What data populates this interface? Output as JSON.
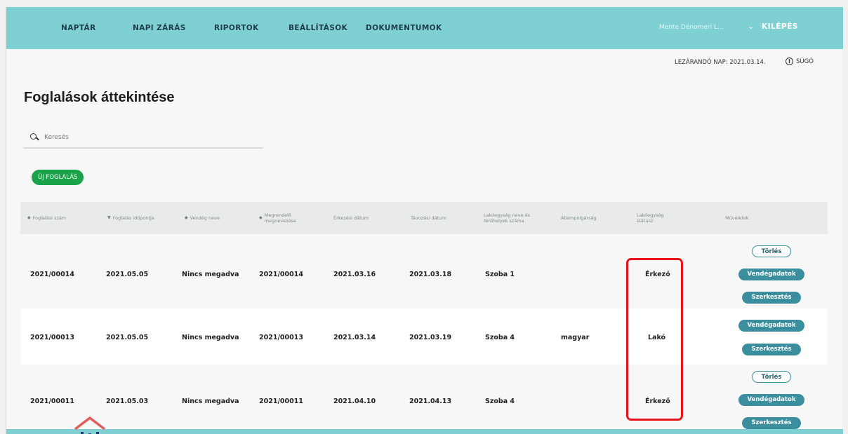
{
  "nav": {
    "items": [
      {
        "label": "NAPTÁR",
        "name": "nav-item-naptar"
      },
      {
        "label": "NAPI ZÁRÁS",
        "name": "nav-item-napi-zaras"
      },
      {
        "label": "RIPORTOK",
        "name": "nav-item-riportok"
      },
      {
        "label": "BEÁLLÍTÁSOK",
        "name": "nav-item-beallitasok"
      },
      {
        "label": "DOKUMENTUMOK",
        "name": "nav-item-dokumentumok"
      }
    ],
    "user": "Mente Dénomeri L...",
    "chevron": "⌄",
    "logout": "KILÉPÉS"
  },
  "info": {
    "close_day": "LEZÁRANDÓ NAP: 2021.03.14.",
    "help": "SÚGÓ",
    "help_icon": "i"
  },
  "page": {
    "title": "Foglalások áttekintése",
    "search_placeholder": "Keresés",
    "new_button": "ÚJ FOGLALÁS"
  },
  "table": {
    "columns": [
      {
        "label": "Foglalási szám",
        "sort": "◆"
      },
      {
        "label": "Foglalás időpontja",
        "sort": "▼"
      },
      {
        "label": "Vendég neve",
        "sort": "◆"
      },
      {
        "label": "Megrendelő megnevezése",
        "sort": "◆"
      },
      {
        "label": "Érkezési dátum",
        "sort": ""
      },
      {
        "label": "Távozási dátum",
        "sort": ""
      },
      {
        "label": "Lakóegység neve és férőhelyek száma",
        "sort": ""
      },
      {
        "label": "Állampolgárság",
        "sort": ""
      },
      {
        "label": "Lakóegység státusz",
        "sort": ""
      },
      {
        "label": "Műveletek",
        "sort": ""
      }
    ],
    "rows": [
      {
        "id": "2021/00014",
        "date": "2021.05.05",
        "guest": "Nincs megadva",
        "orderer": "2021/00014",
        "arrival": "2021.03.16",
        "departure": "2021.03.18",
        "unit": "Szoba 1",
        "nationality": "",
        "status": "Érkező",
        "actions": [
          "Törlés",
          "Vendégadatok",
          "Szerkesztés"
        ]
      },
      {
        "id": "2021/00013",
        "date": "2021.05.05",
        "guest": "Nincs megadva",
        "orderer": "2021/00013",
        "arrival": "2021.03.14",
        "departure": "2021.03.19",
        "unit": "Szoba 4",
        "nationality": "magyar",
        "status": "Lakó",
        "actions": [
          "Vendégadatok",
          "Szerkesztés"
        ]
      },
      {
        "id": "2021/00011",
        "date": "2021.05.03",
        "guest": "Nincs megadva",
        "orderer": "2021/00011",
        "arrival": "2021.04.10",
        "departure": "2021.04.13",
        "unit": "Szoba 4",
        "nationality": "",
        "status": "Érkező",
        "actions": [
          "Törlés",
          "Vendégadatok",
          "Szerkesztés"
        ]
      }
    ]
  },
  "colors": {
    "topbar": "#7ed0d3",
    "action_teal": "#3a8e9e",
    "new_button_green": "#1ba34a",
    "highlight_red": "#e8141b",
    "logo_red": "#e35d5d",
    "logo_navy": "#1f3a6b"
  }
}
